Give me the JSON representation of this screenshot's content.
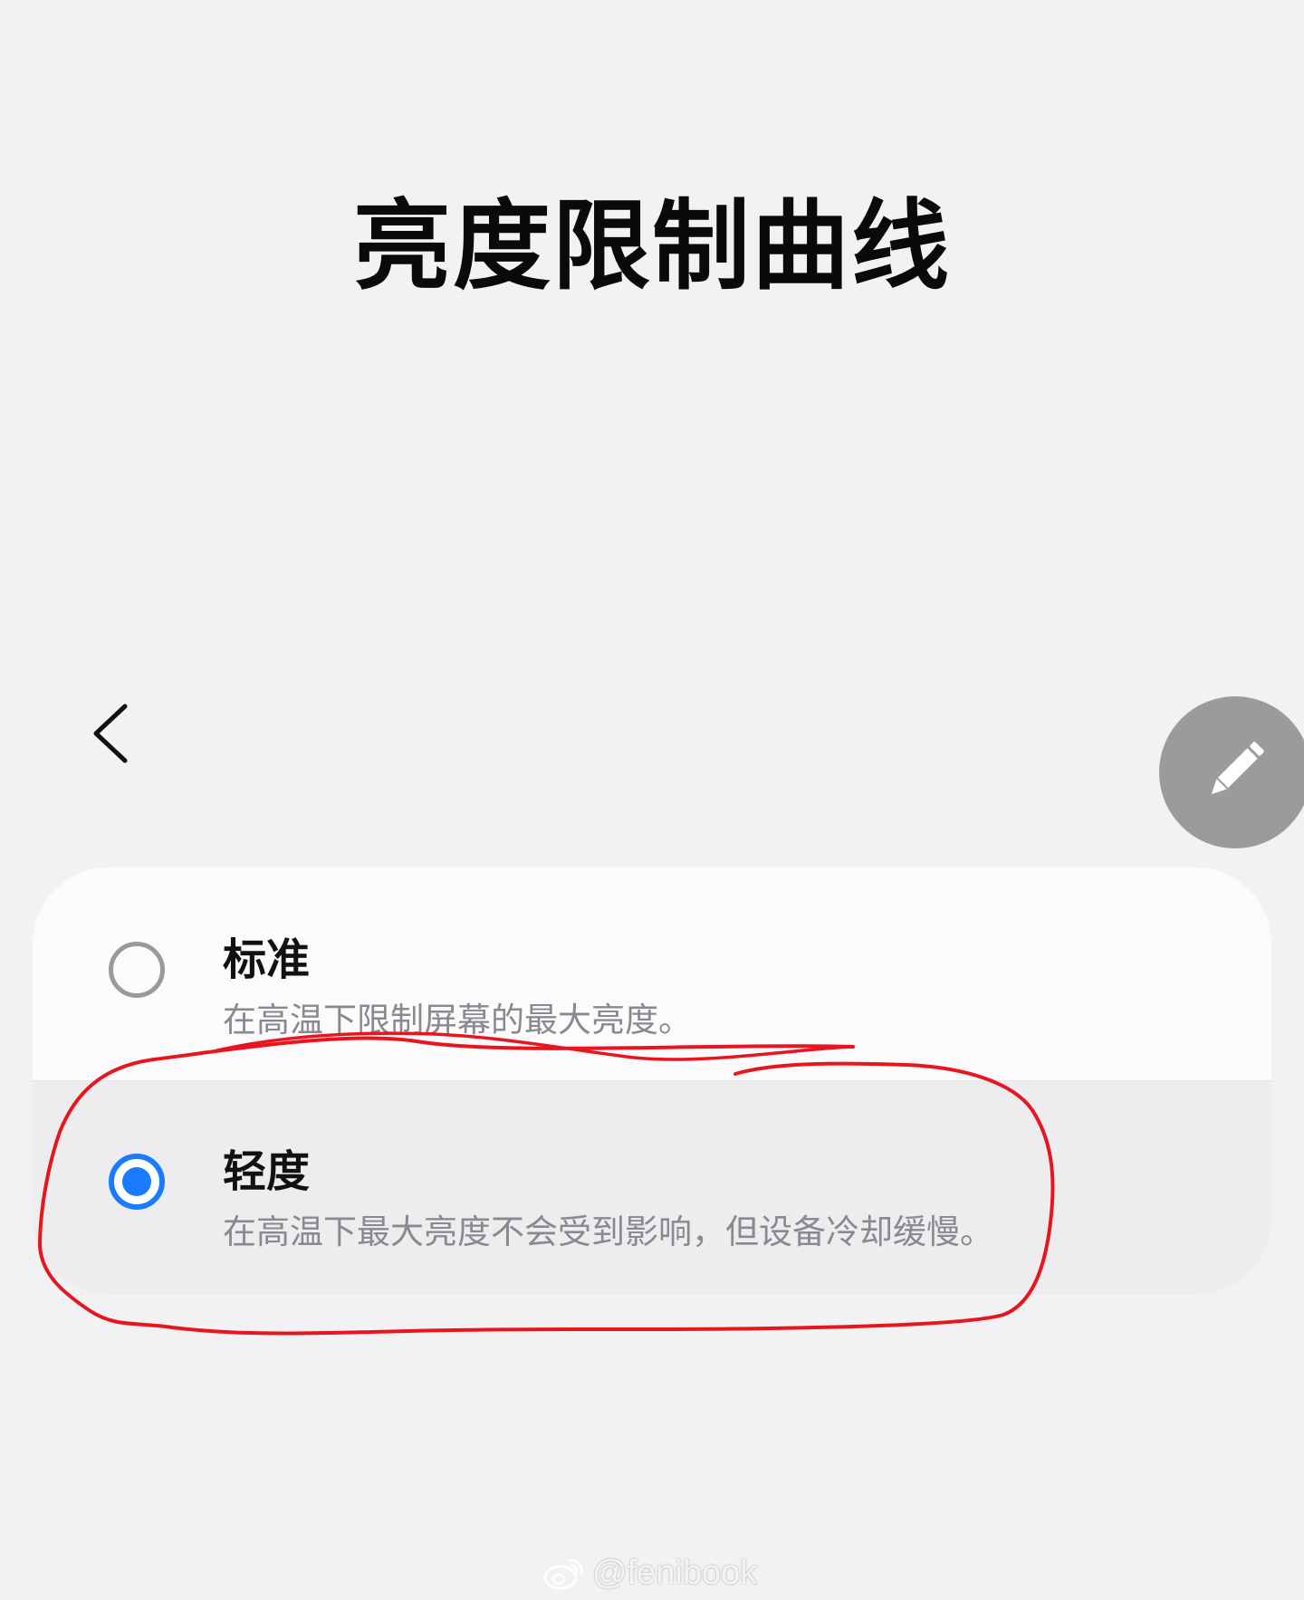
{
  "header": {
    "title": "亮度限制曲线"
  },
  "nav": {
    "back_icon": "chevron-left-icon",
    "edit_icon": "pencil-icon"
  },
  "options": [
    {
      "title": "标准",
      "description": "在高温下限制屏幕的最大亮度。",
      "selected": false
    },
    {
      "title": "轻度",
      "description": "在高温下最大亮度不会受到影响，但设备冷却缓慢。",
      "selected": true
    }
  ],
  "watermark": {
    "text": "@fenibook",
    "icon": "weibo-icon"
  },
  "colors": {
    "background": "#f2f2f4",
    "card": "#fbfbfd",
    "selected_row": "#ededf0",
    "accent": "#1a7bff",
    "annotation": "#e8151f",
    "fab": "#9b9b9e"
  }
}
